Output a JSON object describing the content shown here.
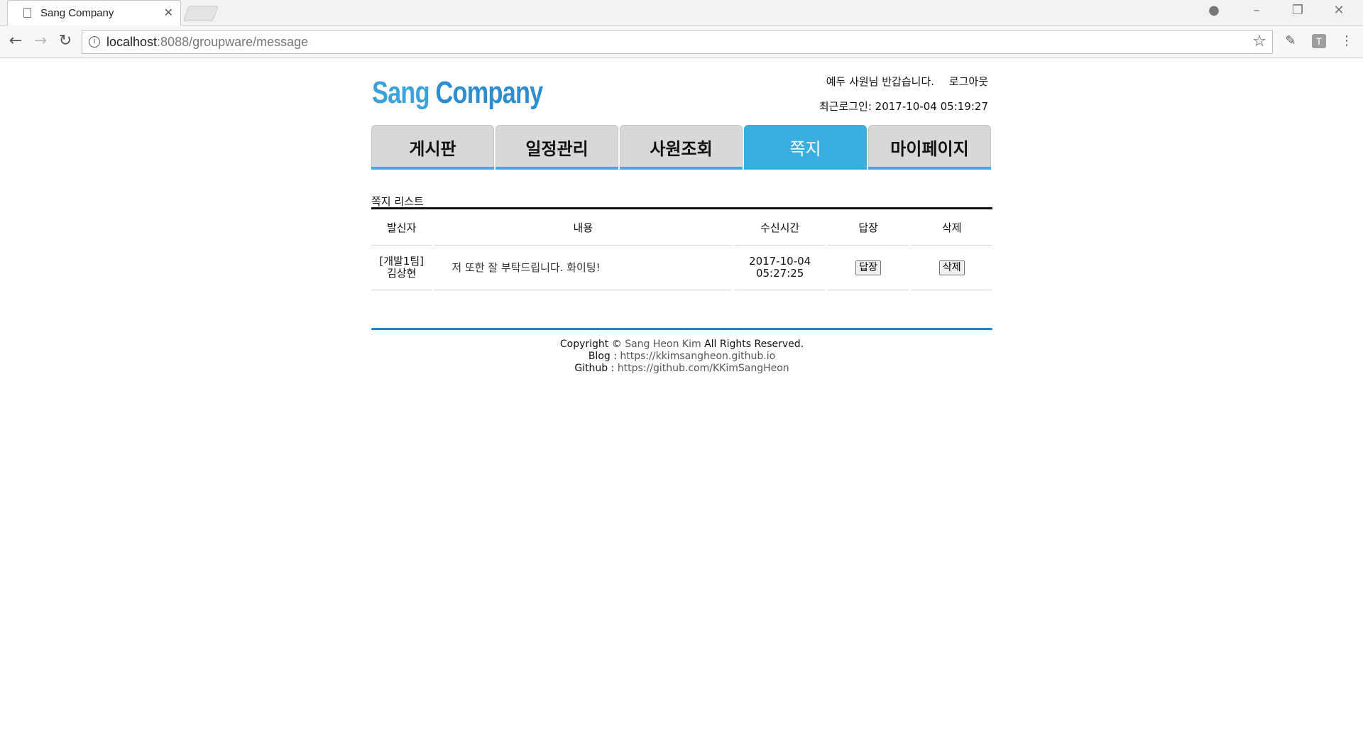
{
  "browser": {
    "tab_title": "Sang Company",
    "url_host": "localhost",
    "url_rest": ":8088/groupware/message"
  },
  "header": {
    "logo_word1": "Sang",
    "logo_word2": "Company",
    "welcome": "예두 사원님 반갑습니다.",
    "logout": "로그아웃",
    "last_login": "최근로그인: 2017-10-04 05:19:27"
  },
  "menu": [
    {
      "label": "게시판"
    },
    {
      "label": "일정관리"
    },
    {
      "label": "사원조회"
    },
    {
      "label": "쪽지"
    },
    {
      "label": "마이페이지"
    }
  ],
  "list": {
    "title": "쪽지 리스트",
    "columns": [
      "발신자",
      "내용",
      "수신시간",
      "답장",
      "삭제"
    ],
    "rows": [
      {
        "sender_team": "[개발1팀]",
        "sender_name": "김상현",
        "content": "저 또한 잘 부탁드립니다. 화이팅!",
        "date": "2017-10-04",
        "time": "05:27:25",
        "reply_label": "답장",
        "delete_label": "삭제"
      }
    ]
  },
  "footer": {
    "copyright_prefix": "Copyright ©",
    "author": "Sang Heon Kim",
    "copyright_suffix": "All Rights Reserved.",
    "blog_label": "Blog :",
    "blog_url": "https://kkimsangheon.github.io",
    "github_label": "Github :",
    "github_url": "https://github.com/KKimSangHeon"
  }
}
